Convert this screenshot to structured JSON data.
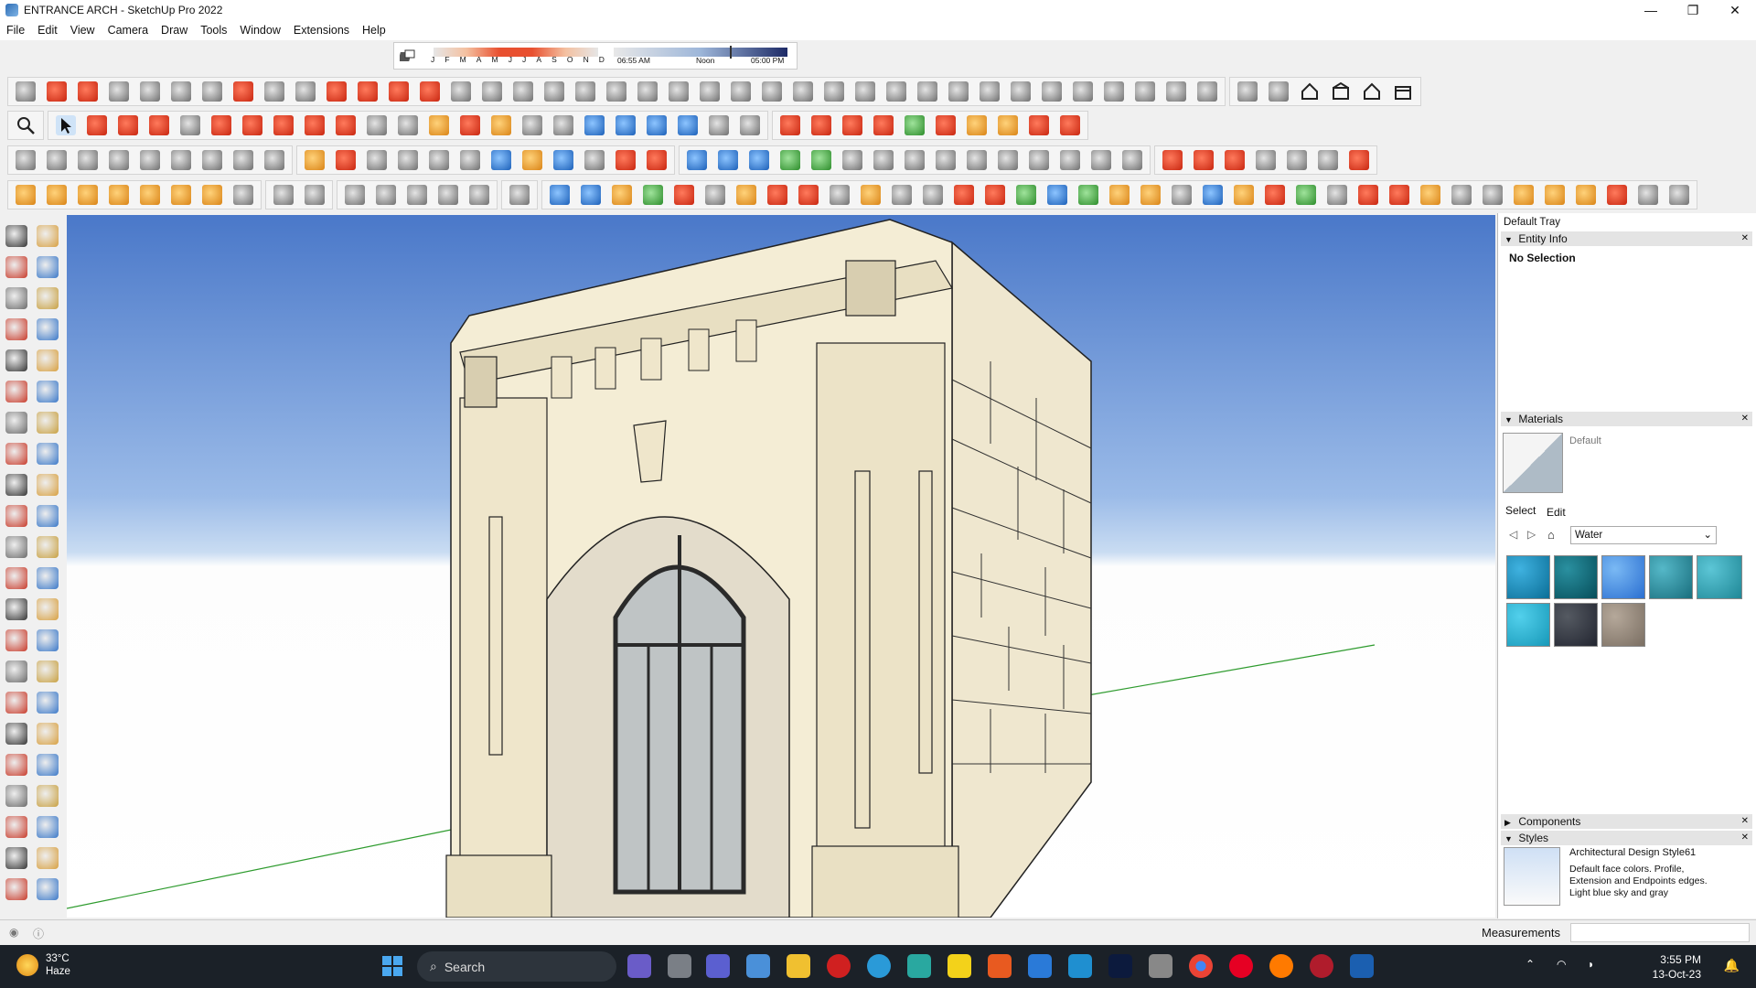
{
  "window": {
    "title": "ENTRANCE ARCH - SketchUp Pro 2022",
    "minimize": "—",
    "maximize": "❐",
    "close": "✕"
  },
  "menu": [
    "File",
    "Edit",
    "View",
    "Camera",
    "Draw",
    "Tools",
    "Window",
    "Extensions",
    "Help"
  ],
  "shadows": {
    "months": [
      "J",
      "F",
      "M",
      "A",
      "M",
      "J",
      "J",
      "A",
      "S",
      "O",
      "N",
      "D"
    ],
    "time_start": "06:55 AM",
    "time_mid": "Noon",
    "time_end": "05:00 PM"
  },
  "tray": {
    "title": "Default Tray",
    "entity_info": {
      "header": "Entity Info",
      "selection": "No Selection"
    },
    "materials": {
      "header": "Materials",
      "current_name": "Default",
      "tab_select": "Select",
      "tab_edit": "Edit",
      "collection": "Water",
      "swatch_count": 8
    },
    "components": {
      "header": "Components"
    },
    "styles": {
      "header": "Styles",
      "style_name": "Architectural Design Style61",
      "description": "Default face colors. Profile, Extension and Endpoints edges. Light blue sky and gray"
    }
  },
  "status": {
    "measurements_label": "Measurements",
    "measurements_value": ""
  },
  "taskbar": {
    "temp": "33°C",
    "condition": "Haze",
    "search_placeholder": "Search",
    "time": "3:55 PM",
    "date": "13-Oct-23"
  }
}
